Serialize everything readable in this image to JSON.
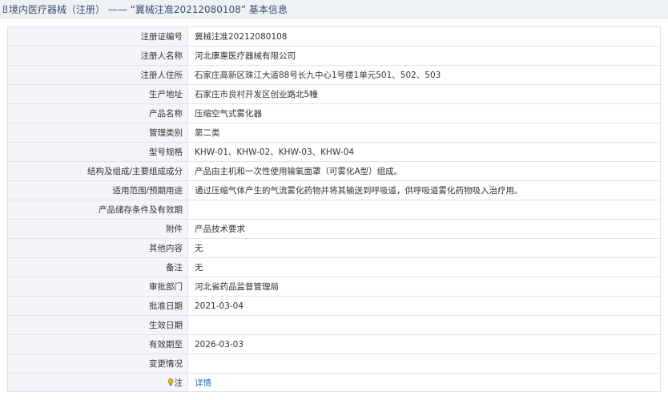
{
  "header": {
    "title": "境内医疗器械（注册） —— “冀械注准20212080108” 基本信息",
    "icon": "document-icon"
  },
  "rows": [
    {
      "label": "注册证编号",
      "value": "冀械注准20212080108"
    },
    {
      "label": "注册人名称",
      "value": "河北康惠医疗器械有限公司"
    },
    {
      "label": "注册人住所",
      "value": "石家庄高新区珠江大道88号长九中心1号楼1单元501、502、503"
    },
    {
      "label": "生产地址",
      "value": "石家庄市良村开发区创业路北5幢"
    },
    {
      "label": "产品名称",
      "value": "压缩空气式雾化器"
    },
    {
      "label": "管理类别",
      "value": "第二类"
    },
    {
      "label": "型号规格",
      "value": "KHW-01、KHW-02、KHW-03、KHW-04"
    },
    {
      "label": "结构及组成/主要组成成分",
      "value": "产品由主机和一次性使用输氧面罩（可雾化A型）组成。"
    },
    {
      "label": "适用范围/预期用途",
      "value": "通过压缩气体产生的气流雾化药物并将其输送到呼吸道，供呼吸道雾化药物吸入治疗用。"
    },
    {
      "label": "产品储存条件及有效期",
      "value": ""
    },
    {
      "label": "附件",
      "value": "产品技术要求"
    },
    {
      "label": "其他内容",
      "value": "无"
    },
    {
      "label": "备注",
      "value": "无"
    },
    {
      "label": "审批部门",
      "value": "河北省药品监督管理局"
    },
    {
      "label": "批准日期",
      "value": "2021-03-04"
    },
    {
      "label": "生效日期",
      "value": ""
    },
    {
      "label": "有效期至",
      "value": "2026-03-03"
    },
    {
      "label": "变更情况",
      "value": ""
    }
  ],
  "note": {
    "label": "注",
    "icon": "lightbulb-icon",
    "link_text": "详情"
  },
  "colors": {
    "header_bg": "#eef1f6",
    "label_bg": "#f3f5f8",
    "border": "#dfe3e9",
    "link": "#2c6fb5"
  }
}
